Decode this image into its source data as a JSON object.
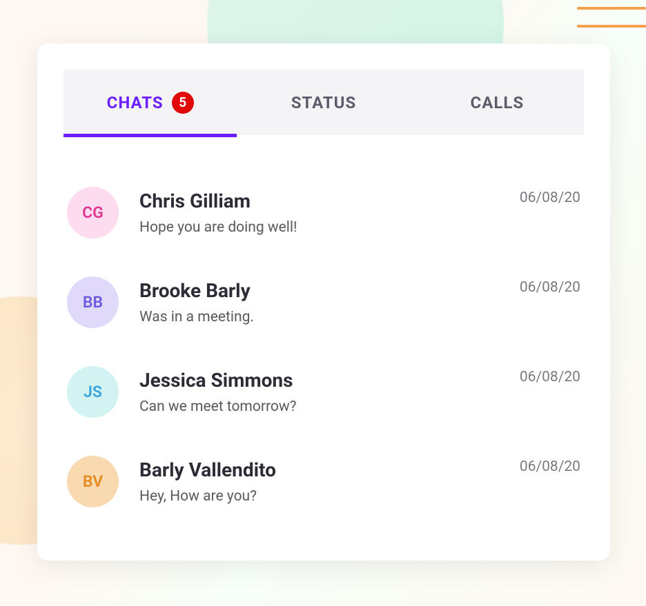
{
  "tabs": [
    {
      "label": "CHATS",
      "badge": "5",
      "active": true
    },
    {
      "label": "STATUS",
      "active": false
    },
    {
      "label": "CALLS",
      "active": false
    }
  ],
  "chats": [
    {
      "initials": "CG",
      "name": "Chris Gilliam",
      "message": "Hope you are doing well!",
      "date": "06/08/20",
      "avatar_bg": "#fcdcee",
      "avatar_fg": "#e0358f"
    },
    {
      "initials": "BB",
      "name": "Brooke Barly",
      "message": "Was in a meeting.",
      "date": "06/08/20",
      "avatar_bg": "#e0d9f9",
      "avatar_fg": "#6e5be0"
    },
    {
      "initials": "JS",
      "name": "Jessica Simmons",
      "message": "Can we meet tomorrow?",
      "date": "06/08/20",
      "avatar_bg": "#d3f3f3",
      "avatar_fg": "#37a4dd"
    },
    {
      "initials": "BV",
      "name": "Barly Vallendito",
      "message": "Hey, How are you?",
      "date": "06/08/20",
      "avatar_bg": "#f9dab0",
      "avatar_fg": "#e88a22"
    }
  ]
}
